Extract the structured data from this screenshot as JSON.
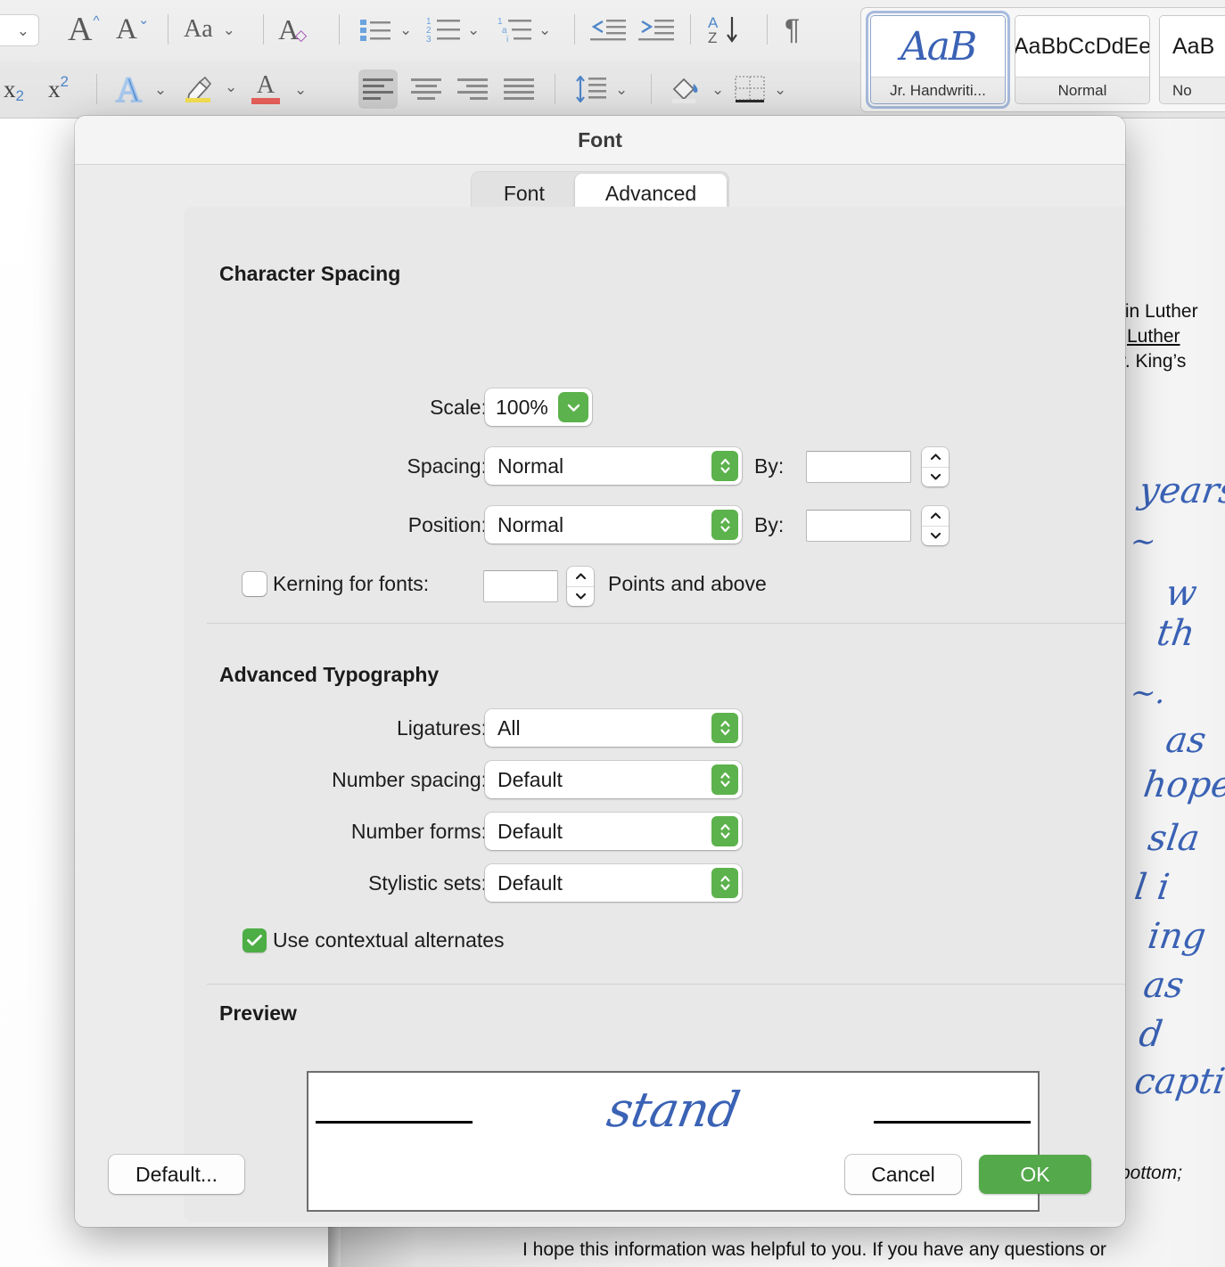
{
  "ribbon": {
    "font_size_value": "",
    "tools_row1": [
      {
        "name": "grow-font-icon",
        "label": "A"
      },
      {
        "name": "shrink-font-icon",
        "label": "A"
      },
      {
        "name": "change-case-icon",
        "label": "Aa"
      },
      {
        "name": "clear-formatting-icon",
        "label": "A"
      }
    ],
    "tools_row2": [
      {
        "name": "subscript-icon",
        "label": "x"
      },
      {
        "name": "superscript-icon",
        "label": "x"
      },
      {
        "name": "text-effects-icon",
        "label": "A"
      },
      {
        "name": "highlight-icon",
        "label": ""
      },
      {
        "name": "font-color-icon",
        "label": "A"
      }
    ],
    "paragraph_tools": [
      {
        "name": "bullets-icon"
      },
      {
        "name": "numbering-icon"
      },
      {
        "name": "multilevel-list-icon"
      },
      {
        "name": "decrease-indent-icon"
      },
      {
        "name": "increase-indent-icon"
      },
      {
        "name": "sort-icon",
        "label_top": "A",
        "label_bottom": "Z"
      },
      {
        "name": "show-formatting-marks-icon",
        "label": "¶"
      }
    ],
    "align_tools": [
      {
        "name": "align-left-icon",
        "selected": true
      },
      {
        "name": "align-center-icon",
        "selected": false
      },
      {
        "name": "align-right-icon",
        "selected": false
      },
      {
        "name": "justify-icon",
        "selected": false
      },
      {
        "name": "line-spacing-icon",
        "selected": false
      },
      {
        "name": "shading-icon",
        "selected": false
      },
      {
        "name": "borders-icon",
        "selected": false
      }
    ],
    "styles": [
      {
        "name": "Jr. Handwriti...",
        "preview": "AaB",
        "handwriting": true,
        "selected": true
      },
      {
        "name": "Normal",
        "preview": "AaBbCcDdEe",
        "handwriting": false,
        "selected": false
      },
      {
        "name": "No",
        "preview": "AaB",
        "handwriting": false,
        "selected": false
      }
    ]
  },
  "document": {
    "fragments": [
      {
        "text": "tin Luther",
        "style": "plain"
      },
      {
        "text": "Luther",
        "style": "link"
      },
      {
        "text": "r. King’s",
        "style": "plain"
      },
      {
        "text": "bottom;",
        "style": "italic"
      }
    ],
    "handwriting_fragments": [
      "years",
      "∼",
      "w",
      "th",
      "∼.",
      "as",
      "hope",
      "sla",
      "l  i",
      "ing",
      "as",
      "d",
      "capti"
    ],
    "bottom_paragraph": "I hope this information was helpful to you. If you have any questions or"
  },
  "dialog": {
    "title": "Font",
    "tabs": [
      {
        "label": "Font",
        "active": false
      },
      {
        "label": "Advanced",
        "active": true
      }
    ],
    "character_spacing": {
      "section_title": "Character Spacing",
      "scale": {
        "label": "Scale:",
        "value": "100%"
      },
      "spacing": {
        "label": "Spacing:",
        "value": "Normal",
        "by_label": "By:",
        "by_value": ""
      },
      "position": {
        "label": "Position:",
        "value": "Normal",
        "by_label": "By:",
        "by_value": ""
      },
      "kerning": {
        "label": "Kerning for fonts:",
        "checked": false,
        "value": "",
        "suffix": "Points and above"
      }
    },
    "advanced_typography": {
      "section_title": "Advanced Typography",
      "rows": [
        {
          "label": "Ligatures:",
          "value": "All"
        },
        {
          "label": "Number spacing:",
          "value": "Default"
        },
        {
          "label": "Number forms:",
          "value": "Default"
        },
        {
          "label": "Stylistic sets:",
          "value": "Default"
        }
      ],
      "contextual_alternates": {
        "label": "Use contextual alternates",
        "checked": true
      }
    },
    "preview": {
      "section_title": "Preview",
      "sample_text": "stand"
    },
    "buttons": {
      "default": "Default...",
      "cancel": "Cancel",
      "ok": "OK"
    }
  },
  "colors": {
    "accent_green": "#54a94b",
    "control_green": "#5cb24c",
    "handwriting_blue": "#3a62b5",
    "dialog_bg": "#ececec",
    "panel_bg": "#e8e8e8"
  }
}
